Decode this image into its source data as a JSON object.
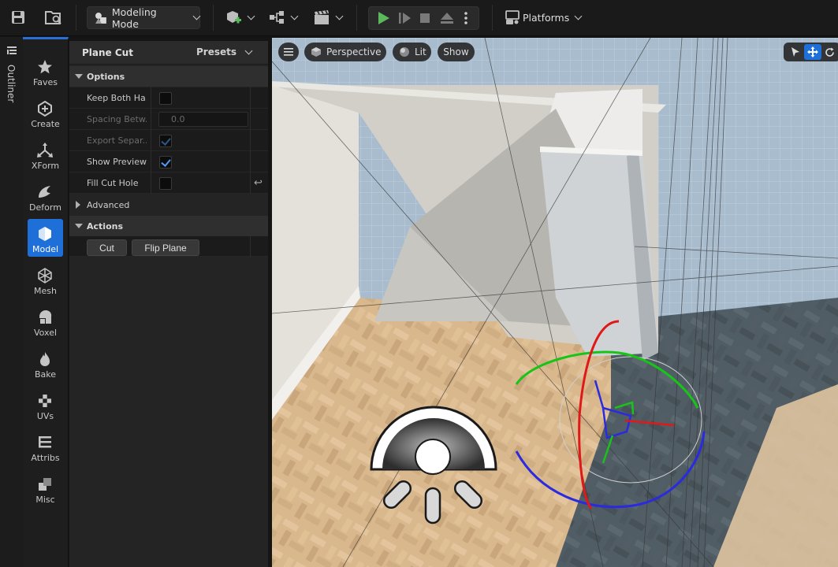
{
  "toolbar": {
    "save_icon": "save-icon",
    "browse_icon": "content-browser-icon",
    "mode_label": "Modeling Mode",
    "add_icon": "add-actor-icon",
    "blueprint_icon": "blueprint-icon",
    "cinematics_icon": "clapperboard-icon",
    "play_colors": {
      "play": "#5cb85c"
    },
    "platforms_label": "Platforms"
  },
  "outliner": {
    "label": "Outliner"
  },
  "palette": {
    "items": [
      {
        "label": "Faves",
        "icon": "star-icon"
      },
      {
        "label": "Create",
        "icon": "create-icon"
      },
      {
        "label": "XForm",
        "icon": "xform-icon"
      },
      {
        "label": "Deform",
        "icon": "deform-icon"
      },
      {
        "label": "Model",
        "icon": "model-icon",
        "active": true
      },
      {
        "label": "Mesh",
        "icon": "mesh-icon"
      },
      {
        "label": "Voxel",
        "icon": "voxel-icon"
      },
      {
        "label": "Bake",
        "icon": "bake-icon"
      },
      {
        "label": "UVs",
        "icon": "uvs-icon"
      },
      {
        "label": "Attribs",
        "icon": "attribs-icon"
      },
      {
        "label": "Misc",
        "icon": "misc-icon"
      }
    ],
    "accent": "#1f6fd8"
  },
  "panel": {
    "title": "Plane Cut",
    "presets": "Presets",
    "options_header": "Options",
    "rows": [
      {
        "label": "Keep Both Ha...",
        "type": "checkbox",
        "checked": false
      },
      {
        "label": "Spacing Betw...",
        "type": "number",
        "value": "0.0",
        "disabled": true
      },
      {
        "label": "Export Separ...",
        "type": "checkbox",
        "checked": true,
        "disabled": true
      },
      {
        "label": "Show Preview",
        "type": "checkbox",
        "checked": true
      },
      {
        "label": "Fill Cut Hole",
        "type": "checkbox",
        "checked": false
      }
    ],
    "advanced_header": "Advanced",
    "actions_header": "Actions",
    "actions": {
      "cut": "Cut",
      "flip": "Flip Plane"
    }
  },
  "viewport": {
    "menu_icon": "hamburger-icon",
    "perspective": "Perspective",
    "lit": "Lit",
    "show": "Show",
    "select_icon": "select-arrow-icon",
    "move_icon": "translate-icon",
    "rotate_icon": "rotate-icon"
  }
}
